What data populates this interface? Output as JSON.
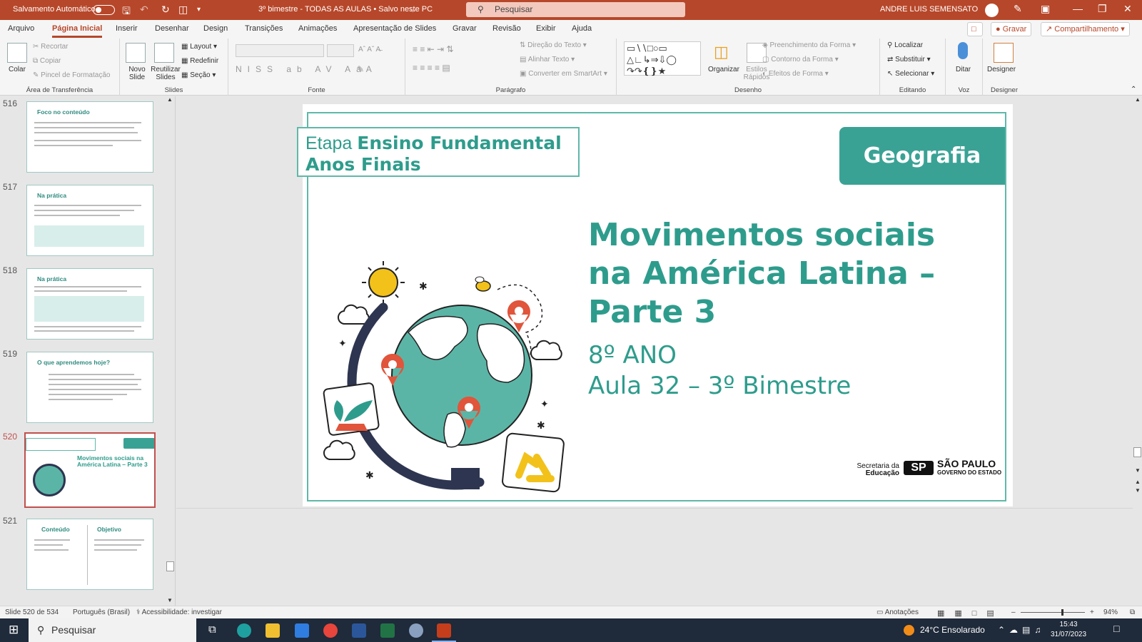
{
  "titlebar": {
    "autosave_label": "Salvamento Automático",
    "doc_title": "3º bimestre - TODAS AS AULAS • Salvo neste PC",
    "search_placeholder": "Pesquisar",
    "user_name": "ANDRE LUIS SEMENSATO",
    "accent_color": "#b7472a"
  },
  "menu": {
    "tabs": [
      "Arquivo",
      "Página Inicial",
      "Inserir",
      "Desenhar",
      "Design",
      "Transições",
      "Animações",
      "Apresentação de Slides",
      "Gravar",
      "Revisão",
      "Exibir",
      "Ajuda"
    ],
    "active": "Página Inicial",
    "record_button": "Gravar",
    "share_button": "Compartilhamento"
  },
  "ribbon": {
    "clipboard": {
      "group": "Área de Transferência",
      "paste": "Colar",
      "cut": "Recortar",
      "copy": "Copiar",
      "format_painter": "Pincel de Formatação"
    },
    "slides": {
      "group": "Slides",
      "new_slide": "Novo Slide",
      "reuse": "Reutilizar Slides",
      "layout": "Layout",
      "reset": "Redefinir",
      "section": "Seção"
    },
    "font": {
      "group": "Fonte"
    },
    "paragraph": {
      "group": "Parágrafo",
      "text_direction": "Direção do Texto",
      "align_text": "Alinhar Texto",
      "smartart": "Converter em SmartArt"
    },
    "drawing": {
      "group": "Desenho",
      "arrange": "Organizar",
      "quick_styles": "Estilos Rápidos",
      "fill": "Preenchimento da Forma",
      "outline": "Contorno da Forma",
      "effects": "Efeitos de Forma"
    },
    "editing": {
      "group": "Editando",
      "find": "Localizar",
      "replace": "Substituir",
      "select": "Selecionar"
    },
    "voice": {
      "group": "Voz",
      "dictate": "Ditar"
    },
    "designer": {
      "group": "Designer",
      "designer": "Designer"
    }
  },
  "thumbnails": [
    {
      "num": "516",
      "title": "Foco no conteúdo"
    },
    {
      "num": "517",
      "title": "Na prática"
    },
    {
      "num": "518",
      "title": "Na prática"
    },
    {
      "num": "519",
      "title": "O que aprendemos hoje?"
    },
    {
      "num": "520",
      "title": "Movimentos sociais na América Latina – Parte 3"
    },
    {
      "num": "521",
      "title_a": "Conteúdo",
      "title_b": "Objetivo"
    }
  ],
  "slide": {
    "etapa_prefix": "Etapa ",
    "etapa_bold_1": "Ensino Fundamental",
    "etapa_bold_2": "Anos Finais",
    "subject": "Geografia",
    "title_line1": "Movimentos sociais",
    "title_line2": "na América Latina –",
    "title_line3": "Parte 3",
    "grade": "8º ANO",
    "lesson": "Aula 32 – 3º Bimestre",
    "logo_line1": "Secretaria da",
    "logo_line2": "Educação",
    "logo_sp": "SP",
    "logo_sao_paulo": "SÃO PAULO",
    "logo_governo": "GOVERNO DO ESTADO",
    "accent_color": "#2e9c8c"
  },
  "status": {
    "slide_counter": "Slide 520 de 534",
    "language": "Português (Brasil)",
    "accessibility": "Acessibilidade: investigar",
    "notes": "Anotações",
    "zoom": "94%"
  },
  "taskbar": {
    "search": "Pesquisar",
    "weather": "24°C  Ensolarado",
    "time": "15:43",
    "date": "31/07/2023"
  }
}
